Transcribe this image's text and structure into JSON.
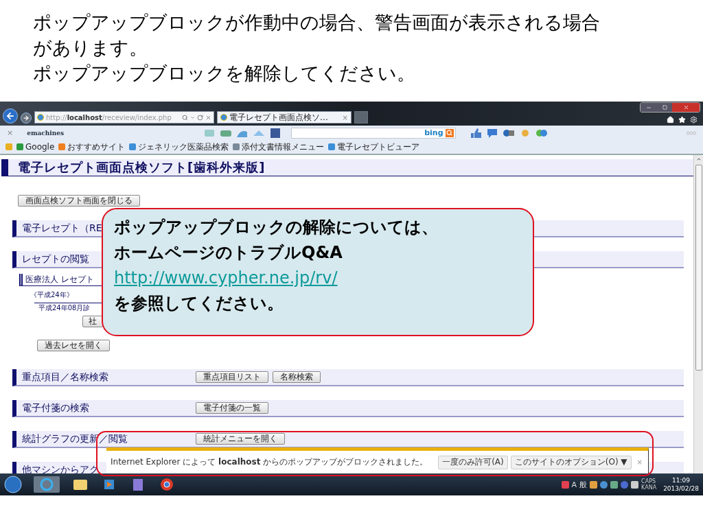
{
  "slide": {
    "title_lines": [
      "ポップアップブロックが作動中の場合、警告画面が表示される場合",
      "があります。",
      "ポップアップブロックを解除してください。"
    ]
  },
  "browser": {
    "address": "http://**localhost**/receview/index.php",
    "tabs": [
      {
        "title": "電子レセプト画面点検ソ…",
        "close": "×"
      }
    ],
    "command_bar": {
      "close": "×",
      "brand": "emachines",
      "search_engine": "bing"
    },
    "favorites": [
      "Google",
      "おすすめサイト",
      "ジェネリック医薬品検索",
      "添付文書情報メニュー",
      "電子レセプトビューア"
    ]
  },
  "page": {
    "title": "電子レセプト画面点検ソフト[歯科外来版]",
    "rows": [
      {
        "kind": "button",
        "label": "画面点検ソフト画面を閉じる"
      },
      {
        "kind": "section",
        "title": "電子レセプト（RE"
      },
      {
        "kind": "section",
        "title": "レセプトの閲覧"
      },
      {
        "kind": "subsection",
        "title": "医療法人 レセプト"
      },
      {
        "kind": "year",
        "title": "《平成24年》"
      },
      {
        "kind": "month",
        "title": "平成24年08月診"
      },
      {
        "kind": "indented_button",
        "label": "社"
      },
      {
        "kind": "button",
        "label": "過去レセを開く"
      },
      {
        "kind": "section",
        "title": "重点項目／名称検索",
        "buttons": [
          "重点項目リスト",
          "名称検索"
        ]
      },
      {
        "kind": "section",
        "title": "電子付箋の検索",
        "buttons": [
          "電子付箋の一覧"
        ]
      },
      {
        "kind": "section",
        "title": "統計グラフの更新／閲覧",
        "buttons": [
          "統計メニューを開く"
        ]
      },
      {
        "kind": "section",
        "title": "他マシンからアク"
      }
    ]
  },
  "popup_notice": {
    "message": "Internet Explorer によって **localhost** からのポップアップがブロックされました。",
    "buttons": [
      "一度のみ許可(A)",
      "このサイトのオプション(O) ▼"
    ],
    "close": "×"
  },
  "taskbar": {
    "ime": [
      "A",
      "般"
    ],
    "lock_keys": [
      "CAPS",
      "KANA"
    ],
    "time": "11:09",
    "date": "2013/02/28"
  },
  "callout": {
    "lines": [
      {
        "kind": "text",
        "text": "ポップアップブロックの解除については、"
      },
      {
        "kind": "text",
        "text": "ホームページのトラブルQ&A"
      },
      {
        "kind": "link",
        "text": "http://www.cypher.ne.jp/rv/"
      },
      {
        "kind": "text",
        "text": "を参照してください。"
      }
    ]
  }
}
